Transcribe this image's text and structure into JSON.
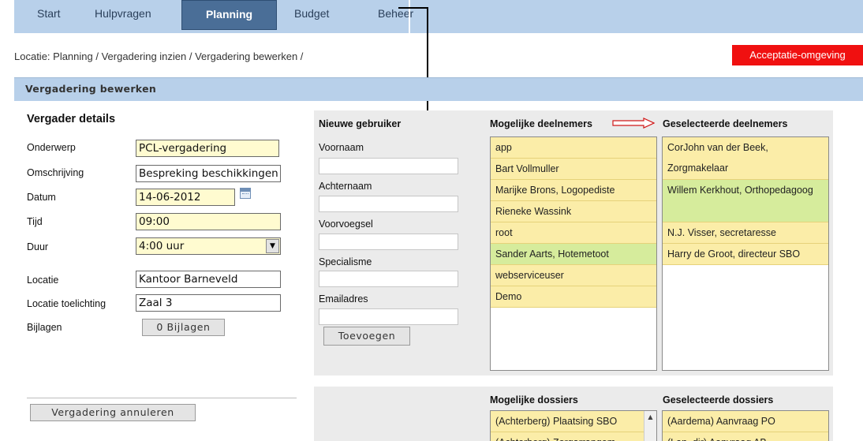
{
  "nav": {
    "items": [
      {
        "label": "Start",
        "active": false
      },
      {
        "label": "Hulpvragen",
        "active": false
      },
      {
        "label": "Planning",
        "active": true
      },
      {
        "label": "Budget",
        "active": false
      },
      {
        "label": "Beheer",
        "active": false
      }
    ]
  },
  "breadcrumb": "Locatie: Planning / Vergadering inzien / Vergadering bewerken /",
  "environment_badge": "Acceptatie-omgeving",
  "section_title": "Vergadering bewerken",
  "details": {
    "title": "Vergader details",
    "fields": {
      "onderwerp": {
        "label": "Onderwerp",
        "value": "PCL-vergadering"
      },
      "omschrijving": {
        "label": "Omschrijving",
        "value": "Bespreking beschikkingen"
      },
      "datum": {
        "label": "Datum",
        "value": "14-06-2012"
      },
      "tijd": {
        "label": "Tijd",
        "value": "09:00"
      },
      "duur": {
        "label": "Duur",
        "value": "4:00 uur"
      },
      "locatie": {
        "label": "Locatie",
        "value": "Kantoor Barneveld"
      },
      "locatie_toelichting": {
        "label": "Locatie toelichting",
        "value": "Zaal 3"
      },
      "bijlagen": {
        "label": "Bijlagen",
        "button": "0 Bijlagen"
      }
    },
    "cancel_button": "Vergadering annuleren"
  },
  "new_user": {
    "title": "Nieuwe gebruiker",
    "fields": [
      "Voornaam",
      "Achternaam",
      "Voorvoegsel",
      "Specialisme",
      "Emailadres"
    ],
    "add_button": "Toevoegen"
  },
  "possible_participants": {
    "title": "Mogelijke deelnemers",
    "items": [
      {
        "label": "app",
        "state": "yellow"
      },
      {
        "label": "Bart Vollmuller",
        "state": "yellow"
      },
      {
        "label": "Marijke Brons, Logopediste",
        "state": "yellow"
      },
      {
        "label": "Rieneke Wassink",
        "state": "yellow"
      },
      {
        "label": "root",
        "state": "yellow"
      },
      {
        "label": "Sander Aarts, Hotemetoot",
        "state": "green"
      },
      {
        "label": "webserviceuser",
        "state": "yellow"
      },
      {
        "label": "Demo",
        "state": "yellow"
      }
    ]
  },
  "selected_participants": {
    "title": "Geselecteerde deelnemers",
    "items": [
      {
        "label": "CorJohn van der Beek, Zorgmakelaar",
        "state": "yellow"
      },
      {
        "label": "Willem Kerkhout, Orthopedagoog",
        "state": "green"
      },
      {
        "label": "N.J. Visser, secretaresse",
        "state": "yellow"
      },
      {
        "label": "Harry de Groot, directeur SBO",
        "state": "yellow"
      }
    ]
  },
  "possible_dossiers": {
    "title": "Mogelijke dossiers",
    "items": [
      {
        "label": "(Achterberg) Plaatsing SBO",
        "state": "yellow"
      },
      {
        "label": "(Achterberg) Zorgarrangem",
        "state": "yellow"
      }
    ]
  },
  "selected_dossiers": {
    "title": "Geselecteerde dossiers",
    "items": [
      {
        "label": "(Aardema) Aanvraag PO",
        "state": "yellow"
      },
      {
        "label": "(Lan..dir) Aanvraag AB...",
        "state": "yellow"
      }
    ]
  }
}
